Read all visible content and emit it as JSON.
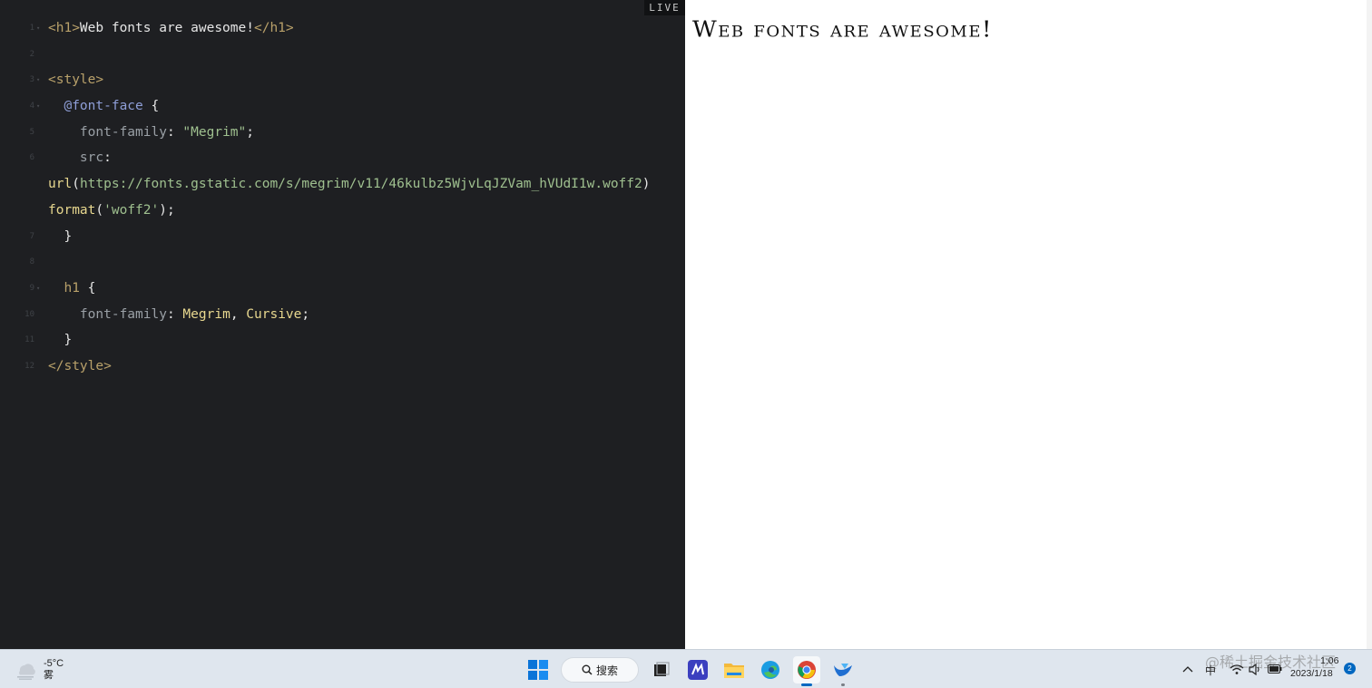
{
  "editor": {
    "live_label": "LIVE",
    "lines": [
      {
        "num": "1",
        "fold": "▾",
        "parts": [
          {
            "c": "tag",
            "t": "<h1>"
          },
          {
            "c": "plain",
            "t": "Web fonts are awesome!"
          },
          {
            "c": "tag",
            "t": "</h1>"
          }
        ]
      },
      {
        "num": "2",
        "fold": "",
        "parts": []
      },
      {
        "num": "3",
        "fold": "▾",
        "parts": [
          {
            "c": "tag",
            "t": "<style>"
          }
        ]
      },
      {
        "num": "4",
        "fold": "▾",
        "parts": [
          {
            "c": "plain",
            "t": "  "
          },
          {
            "c": "at",
            "t": "@font-face"
          },
          {
            "c": "plain",
            "t": " {"
          }
        ]
      },
      {
        "num": "5",
        "fold": "",
        "parts": [
          {
            "c": "plain",
            "t": "    "
          },
          {
            "c": "prop",
            "t": "font-family"
          },
          {
            "c": "plain",
            "t": ": "
          },
          {
            "c": "str",
            "t": "\"Megrim\""
          },
          {
            "c": "plain",
            "t": ";"
          }
        ]
      },
      {
        "num": "6",
        "fold": "",
        "parts": [
          {
            "c": "plain",
            "t": "    "
          },
          {
            "c": "prop",
            "t": "src"
          },
          {
            "c": "plain",
            "t": ":"
          }
        ]
      },
      {
        "num": "",
        "fold": "",
        "parts": [
          {
            "c": "fn",
            "t": "url"
          },
          {
            "c": "plain",
            "t": "("
          },
          {
            "c": "str",
            "t": "https://fonts.gstatic.com/s/megrim/v11/46kulbz5WjvLqJZVam_hVUdI1w.woff2"
          },
          {
            "c": "plain",
            "t": ")"
          }
        ]
      },
      {
        "num": "",
        "fold": "",
        "parts": [
          {
            "c": "fn",
            "t": "format"
          },
          {
            "c": "plain",
            "t": "("
          },
          {
            "c": "str",
            "t": "'woff2'"
          },
          {
            "c": "plain",
            "t": ");"
          }
        ]
      },
      {
        "num": "7",
        "fold": "",
        "parts": [
          {
            "c": "plain",
            "t": "  }"
          }
        ]
      },
      {
        "num": "8",
        "fold": "",
        "parts": []
      },
      {
        "num": "9",
        "fold": "▾",
        "parts": [
          {
            "c": "plain",
            "t": "  "
          },
          {
            "c": "tag",
            "t": "h1"
          },
          {
            "c": "plain",
            "t": " {"
          }
        ]
      },
      {
        "num": "10",
        "fold": "",
        "parts": [
          {
            "c": "plain",
            "t": "    "
          },
          {
            "c": "prop",
            "t": "font-family"
          },
          {
            "c": "plain",
            "t": ": "
          },
          {
            "c": "val",
            "t": "Megrim"
          },
          {
            "c": "plain",
            "t": ", "
          },
          {
            "c": "val",
            "t": "Cursive"
          },
          {
            "c": "plain",
            "t": ";"
          }
        ]
      },
      {
        "num": "11",
        "fold": "",
        "parts": [
          {
            "c": "plain",
            "t": "  }"
          }
        ]
      },
      {
        "num": "12",
        "fold": "",
        "parts": [
          {
            "c": "tag",
            "t": "</style>"
          }
        ]
      }
    ]
  },
  "preview": {
    "heading": "Web fonts are awesome!"
  },
  "taskbar": {
    "weather_temp": "-5°C",
    "weather_desc": "雾",
    "search_label": "搜索",
    "apps": [
      {
        "name": "start-button",
        "icon": "windows-icon",
        "state": ""
      },
      {
        "name": "search",
        "icon": "search-icon",
        "state": ""
      },
      {
        "name": "task-view-button",
        "icon": "task-view-icon",
        "state": ""
      },
      {
        "name": "app-editor-button",
        "icon": "editor-app-icon",
        "state": ""
      },
      {
        "name": "file-explorer-button",
        "icon": "folder-icon",
        "state": ""
      },
      {
        "name": "edge-button",
        "icon": "edge-icon",
        "state": ""
      },
      {
        "name": "chrome-button",
        "icon": "chrome-icon",
        "state": "active"
      },
      {
        "name": "app-bird-button",
        "icon": "bird-app-icon",
        "state": "running"
      }
    ],
    "tray": {
      "ime": "中",
      "time": "1:06",
      "date": "2023/1/18",
      "notifications": "2"
    },
    "watermark": "@稀土掘金技术社区"
  }
}
